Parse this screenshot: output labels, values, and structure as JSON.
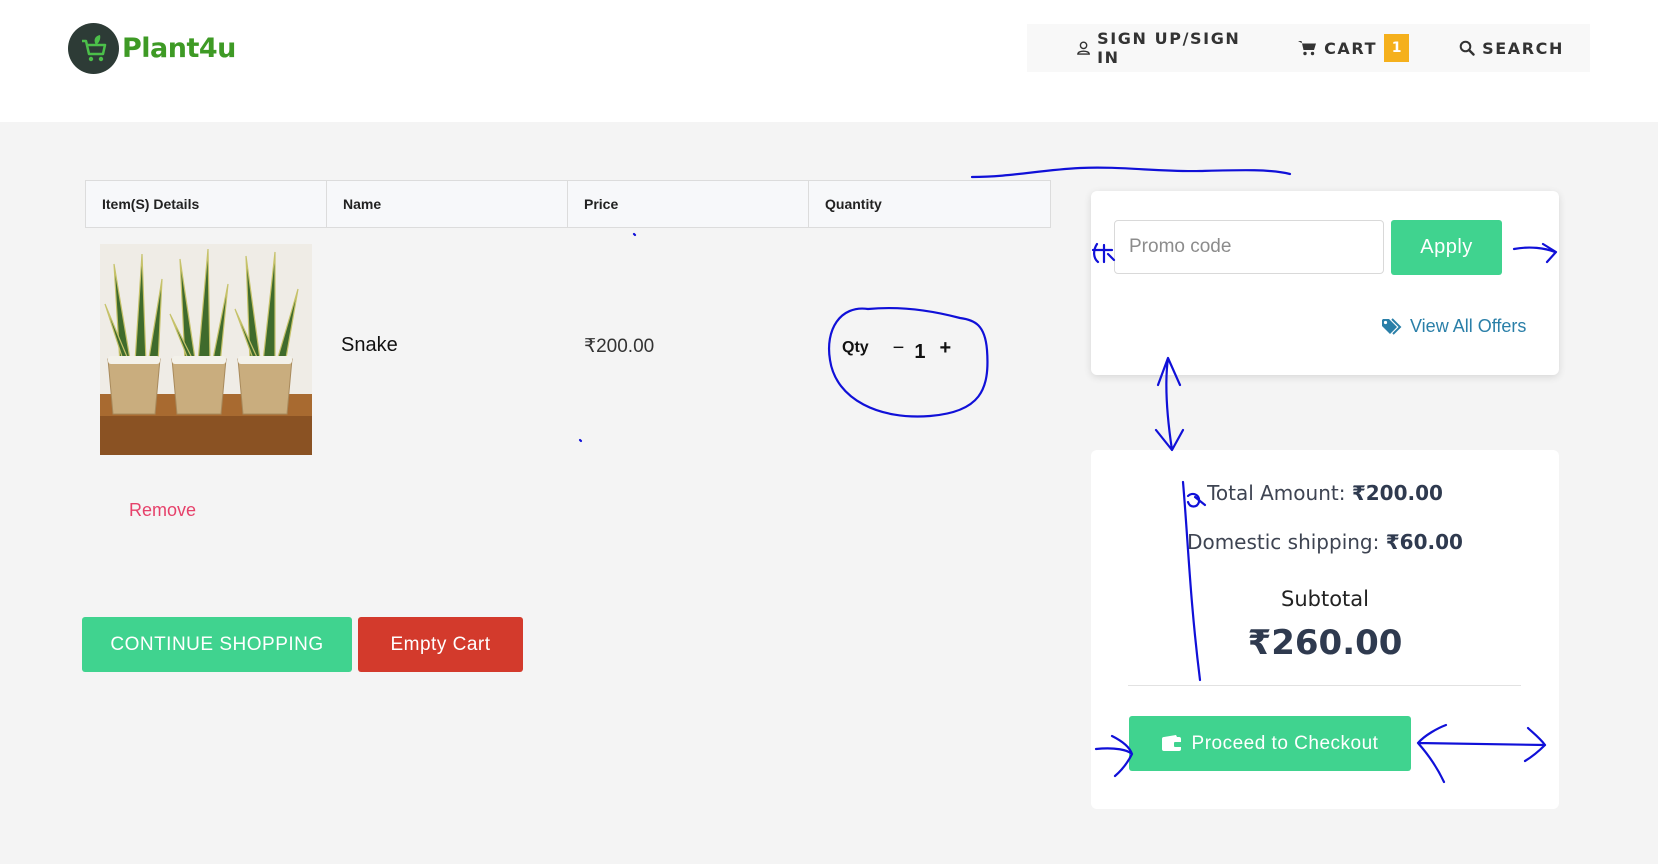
{
  "header": {
    "logo_text": "Plant4u",
    "nav": {
      "signin_label": "SIGN UP/SIGN IN",
      "cart_label": "CART",
      "cart_count": "1",
      "search_label": "SEARCH"
    }
  },
  "cart": {
    "columns": [
      "Item(S) Details",
      "Name",
      "Price",
      "Quantity"
    ],
    "items": [
      {
        "name": "Snake",
        "price": "₹200.00",
        "qty_label": "Qty",
        "qty_minus": "−",
        "qty_value": "1",
        "qty_plus": "+",
        "remove_label": "Remove"
      }
    ],
    "continue_label": "CONTINUE SHOPPING",
    "empty_label": "Empty Cart"
  },
  "promo": {
    "placeholder": "Promo code",
    "apply_label": "Apply",
    "view_offers_label": "View All Offers"
  },
  "summary": {
    "total_label": "Total Amount:",
    "total_value": "₹200.00",
    "shipping_label": "Domestic shipping:",
    "shipping_value": "₹60.00",
    "subtotal_label": "Subtotal",
    "subtotal_value": "₹260.00",
    "checkout_label": "Proceed to Checkout"
  },
  "colors": {
    "accent_green": "#40d38f",
    "danger_red": "#d33a2c",
    "cart_badge": "#f5b01c",
    "link_blue": "#2a7fa8",
    "remove_pink": "#e6416a",
    "annotation_ink": "#1010d8"
  }
}
